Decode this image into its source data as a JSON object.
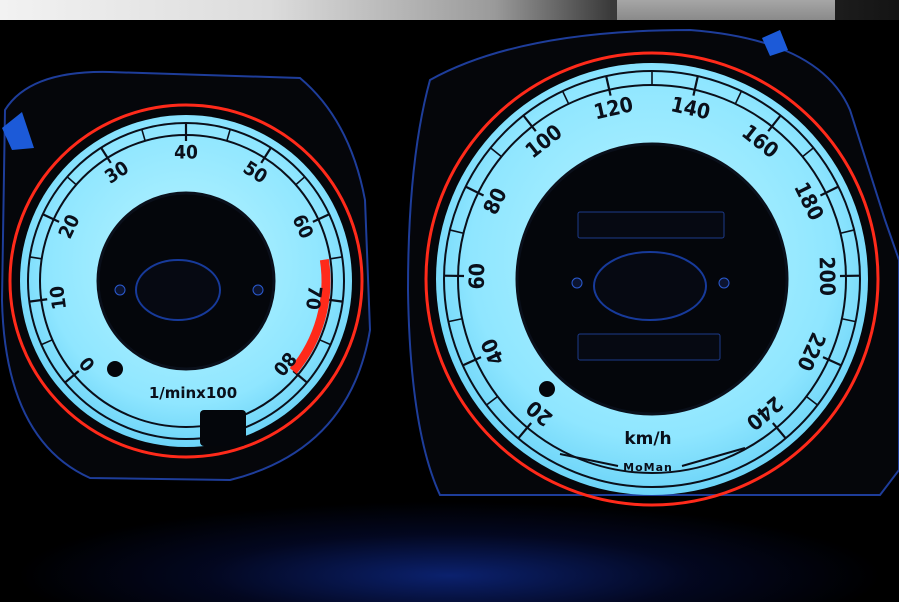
{
  "tachometer": {
    "scale_labels": [
      "0",
      "10",
      "20",
      "30",
      "40",
      "50",
      "60",
      "70",
      "80"
    ],
    "unit_label": "1/minx100",
    "redline_from": 65
  },
  "speedometer": {
    "scale_labels": [
      "20",
      "40",
      "60",
      "80",
      "100",
      "120",
      "140",
      "160",
      "180",
      "200",
      "220",
      "240"
    ],
    "unit_label": "km/h",
    "brand_label": "MoMan"
  },
  "colors": {
    "face": "#8fe6ff",
    "ring": "#ff2a1a",
    "ink": "#0a0f1a",
    "background": "#000000"
  }
}
